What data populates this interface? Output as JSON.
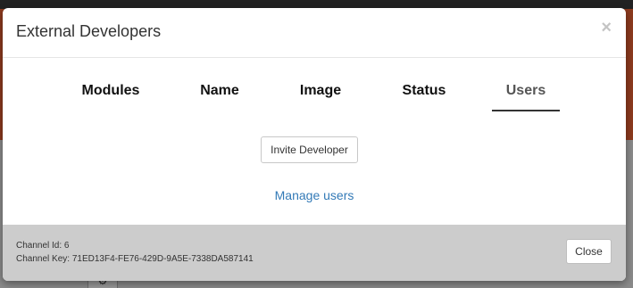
{
  "modal": {
    "title": "External Developers",
    "close_icon": "×"
  },
  "tabs": [
    {
      "label": "Modules",
      "active": false
    },
    {
      "label": "Name",
      "active": false
    },
    {
      "label": "Image",
      "active": false
    },
    {
      "label": "Status",
      "active": false
    },
    {
      "label": "Users",
      "active": true
    }
  ],
  "users_panel": {
    "invite_button": "Invite Developer",
    "manage_link": "Manage users"
  },
  "footer": {
    "channel_id": "Channel Id: 6",
    "channel_key": "Channel Key: 71ED13F4-FE76-429D-9A5E-7338DA587141",
    "close_button": "Close"
  },
  "background": {
    "gear_icon": "⚙"
  },
  "colors": {
    "link": "#337ab7",
    "backdrop_accent": "#8c3a1e",
    "footer_bg": "#cccccc"
  }
}
